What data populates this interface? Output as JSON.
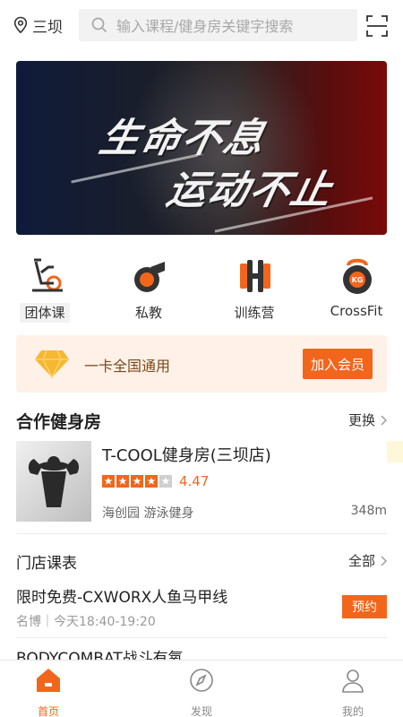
{
  "header": {
    "location": "三坝",
    "search_placeholder": "输入课程/健身房关键字搜索"
  },
  "banner": {
    "line1": "生命不息",
    "line2": "运动不止"
  },
  "categories": [
    {
      "label": "团体课",
      "icon": "exercise-bike-icon"
    },
    {
      "label": "私教",
      "icon": "whistle-icon"
    },
    {
      "label": "训练营",
      "icon": "dumbbell-icon"
    },
    {
      "label": "CrossFit",
      "icon": "kettlebell-icon"
    }
  ],
  "kettlebell_text": "KG",
  "member": {
    "text": "一卡全国通用",
    "button": "加入会员"
  },
  "partner": {
    "title": "合作健身房",
    "more": "更换"
  },
  "gym": {
    "name": "T-COOL健身房(三坝店)",
    "rating": 4.47,
    "rating_text": "4.47",
    "stars_filled": 4,
    "tags": "海创园  游泳健身",
    "distance": "348m"
  },
  "schedule": {
    "title": "门店课表",
    "more": "全部",
    "course_name": "限时免费-CXWORX人鱼马甲线",
    "course_sub": "名博｜今天18:40-19:20",
    "book": "预约",
    "next_course": "BODYCOMBAT战斗有氧"
  },
  "tabs": [
    {
      "label": "首页",
      "active": true
    },
    {
      "label": "发现",
      "active": false
    },
    {
      "label": "我的",
      "active": false
    }
  ],
  "colors": {
    "accent": "#f2661c",
    "member_bg": "#fff1e8"
  }
}
